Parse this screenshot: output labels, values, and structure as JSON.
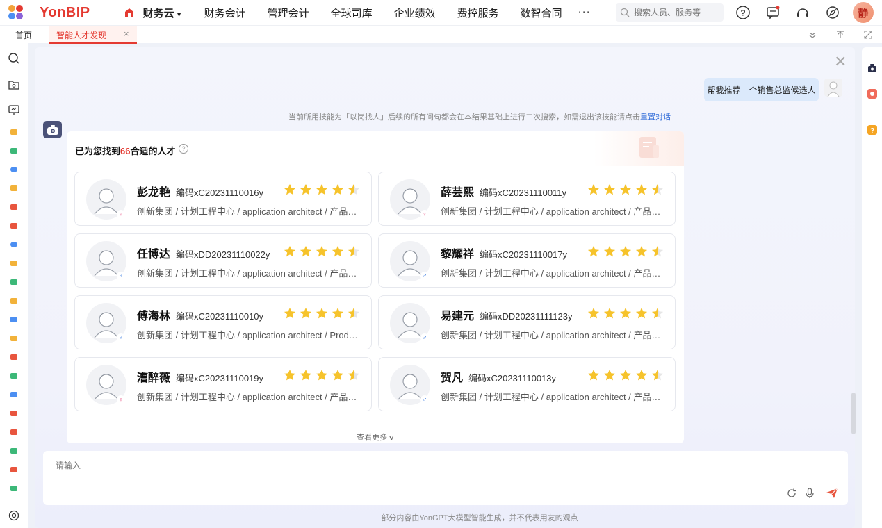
{
  "app": {
    "brand": "YonBIP",
    "avatar_char": "静"
  },
  "topnav": {
    "items": [
      "财务云",
      "财务会计",
      "管理会计",
      "全球司库",
      "企业绩效",
      "费控服务",
      "数智合同"
    ],
    "more": "···",
    "search_placeholder": "搜索人员、服务等"
  },
  "tabs": {
    "home": "首页",
    "active": "智能人才发现",
    "close": "×"
  },
  "chat": {
    "user_message": "帮我推荐一个销售总监候选人",
    "hint_text": "当前所用技能为「以岗找人」后续的所有问句都会在本结果基础上进行二次搜索，如需退出该技能请点击",
    "hint_link": "重置对话",
    "result_prefix": "已为您找到",
    "result_count": "66",
    "result_suffix": "合适的人才",
    "help": "?",
    "see_more": "查看更多",
    "input_placeholder": "请输入",
    "footer_note": "部分内容由YonGPT大模型智能生成，并不代表用友的观点"
  },
  "candidates": [
    {
      "name": "彭龙艳",
      "code": "编码xC20231110016y",
      "dept": "创新集团 / 计划工程中心 / application architect / 产品经理",
      "gender": "♀",
      "rating": 4.5
    },
    {
      "name": "薛芸熙",
      "code": "编码xC20231110011y",
      "dept": "创新集团 / 计划工程中心 / application architect / 产品经理",
      "gender": "♀",
      "rating": 4.5
    },
    {
      "name": "任博达",
      "code": "编码xDD20231110022y",
      "dept": "创新集团 / 计划工程中心 / application architect / 产品经理",
      "gender": "♂",
      "rating": 4.5
    },
    {
      "name": "黎耀祥",
      "code": "编码xC20231110017y",
      "dept": "创新集团 / 计划工程中心 / application architect / 产品经理",
      "gender": "♂",
      "rating": 4.5
    },
    {
      "name": "傅海林",
      "code": "编码xC20231110010y",
      "dept": "创新集团 / 计划工程中心 / application architect / Product Manager",
      "gender": "♂",
      "rating": 4.5
    },
    {
      "name": "易建元",
      "code": "编码xDD20231111123y",
      "dept": "创新集团 / 计划工程中心 / application architect / 产品经理",
      "gender": "♂",
      "rating": 4.5
    },
    {
      "name": "漕醉薇",
      "code": "编码xC20231110019y",
      "dept": "创新集团 / 计划工程中心 / application architect / 产品经理",
      "gender": "♀",
      "rating": 4.5
    },
    {
      "name": "贺凡",
      "code": "编码xC20231110013y",
      "dept": "创新集团 / 计划工程中心 / application architect / 产品经理",
      "gender": "♂",
      "rating": 4.5
    }
  ],
  "colors": {
    "brand_red": "#e43a31",
    "star": "#f6c32b",
    "link_blue": "#2f6bd8"
  }
}
